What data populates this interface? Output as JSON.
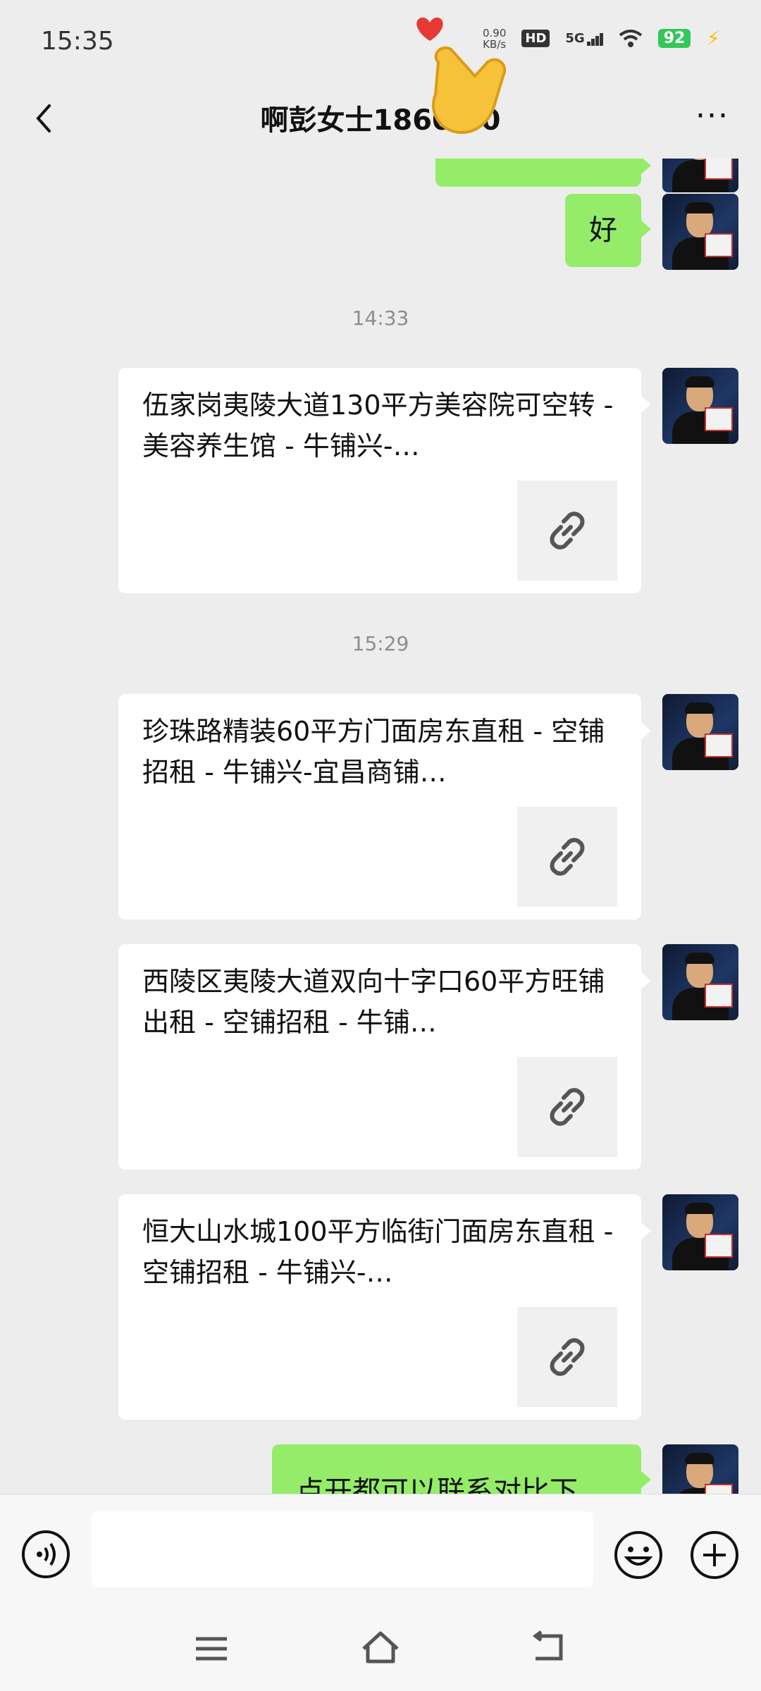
{
  "status_bar": {
    "time": "15:35",
    "net_speed_value": "0.90",
    "net_speed_unit": "KB/s",
    "hd": "HD",
    "network": "5G",
    "battery": "92"
  },
  "header": {
    "title": "啊彭女士1860 90"
  },
  "chat": {
    "messages": [
      {
        "type": "text",
        "from": "me",
        "text": "好"
      },
      {
        "type": "time",
        "text": "14:33"
      },
      {
        "type": "link",
        "from": "me",
        "title": "伍家岗夷陵大道130平方美容院可空转 - 美容养生馆 - 牛铺兴-…"
      },
      {
        "type": "time",
        "text": "15:29"
      },
      {
        "type": "link",
        "from": "me",
        "title": "珍珠路精装60平方门面房东直租 - 空铺招租 - 牛铺兴-宜昌商铺…"
      },
      {
        "type": "link",
        "from": "me",
        "title": "西陵区夷陵大道双向十字口60平方旺铺出租 - 空铺招租 - 牛铺…"
      },
      {
        "type": "link",
        "from": "me",
        "title": "恒大山水城100平方临街门面房东直租 - 空铺招租 - 牛铺兴-…"
      },
      {
        "type": "text",
        "from": "me",
        "text": "点开都可以联系对比下"
      }
    ]
  },
  "input": {
    "placeholder": ""
  },
  "icons": {
    "back": "back-arrow-icon",
    "more": "more-icon",
    "link": "link-icon",
    "voice": "voice-icon",
    "emoji": "emoji-icon",
    "plus": "plus-icon",
    "menu": "menu-icon",
    "home": "home-icon",
    "sys_back": "system-back-icon"
  },
  "colors": {
    "chat_bg": "#ededed",
    "bubble_me": "#95ec69",
    "card_bg": "#ffffff",
    "battery": "#34c759"
  }
}
